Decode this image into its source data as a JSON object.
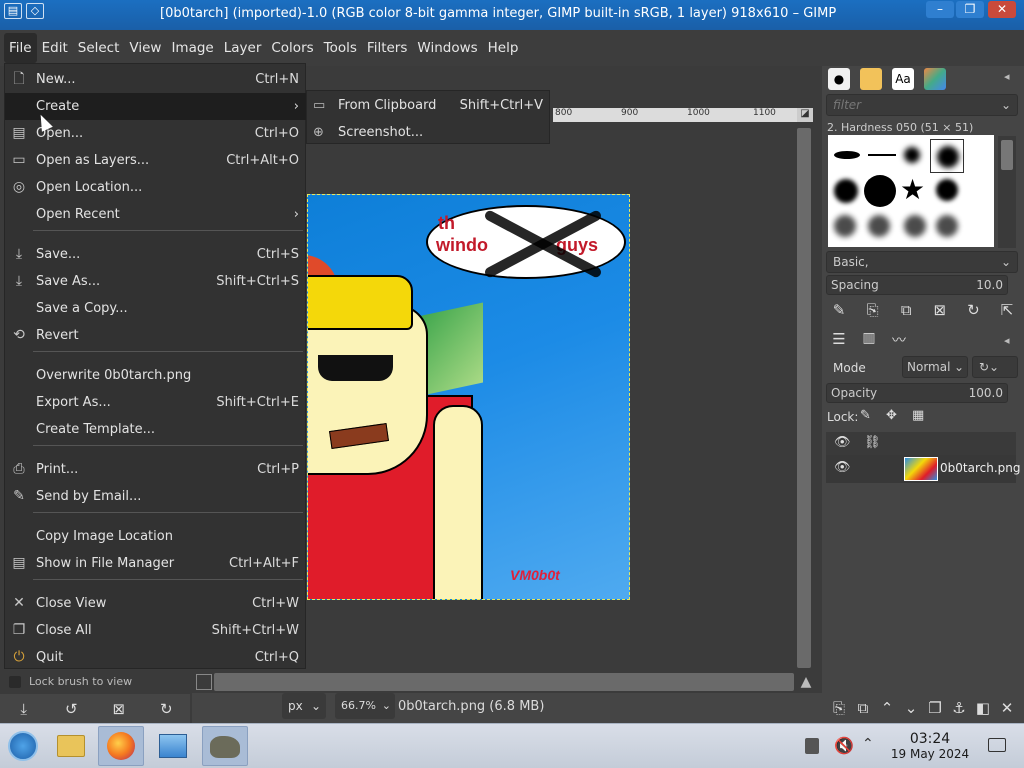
{
  "window": {
    "title": "[0b0tarch] (imported)-1.0 (RGB color 8-bit gamma integer, GIMP built-in sRGB, 1 layer) 918x610 – GIMP",
    "controls": [
      "–",
      "❐",
      "✕"
    ]
  },
  "menubar": [
    "File",
    "Edit",
    "Select",
    "View",
    "Image",
    "Layer",
    "Colors",
    "Tools",
    "Filters",
    "Windows",
    "Help"
  ],
  "file_menu": {
    "items": [
      {
        "label": "New...",
        "shortcut": "Ctrl+N",
        "icon": "new-file-icon"
      },
      {
        "label": "Create",
        "shortcut": "",
        "icon": "",
        "submenu": true,
        "highlight": true
      },
      {
        "label": "Open...",
        "shortcut": "Ctrl+O",
        "icon": "open-icon"
      },
      {
        "label": "Open as Layers...",
        "shortcut": "Ctrl+Alt+O",
        "icon": "open-layers-icon"
      },
      {
        "label": "Open Location...",
        "shortcut": "",
        "icon": "globe-icon"
      },
      {
        "label": "Open Recent",
        "shortcut": "",
        "icon": "",
        "submenu": true
      },
      {
        "label": "Save...",
        "shortcut": "Ctrl+S",
        "icon": "save-icon"
      },
      {
        "label": "Save As...",
        "shortcut": "Shift+Ctrl+S",
        "icon": "save-as-icon"
      },
      {
        "label": "Save a Copy...",
        "shortcut": "",
        "icon": ""
      },
      {
        "label": "Revert",
        "shortcut": "",
        "icon": "revert-icon"
      },
      {
        "label": "Overwrite 0b0tarch.png",
        "shortcut": "",
        "icon": ""
      },
      {
        "label": "Export As...",
        "shortcut": "Shift+Ctrl+E",
        "icon": ""
      },
      {
        "label": "Create Template...",
        "shortcut": "",
        "icon": ""
      },
      {
        "label": "Print...",
        "shortcut": "Ctrl+P",
        "icon": "print-icon"
      },
      {
        "label": "Send by Email...",
        "shortcut": "",
        "icon": "email-icon"
      },
      {
        "label": "Copy Image Location",
        "shortcut": "",
        "icon": ""
      },
      {
        "label": "Show in File Manager",
        "shortcut": "Ctrl+Alt+F",
        "icon": "file-manager-icon"
      },
      {
        "label": "Close View",
        "shortcut": "Ctrl+W",
        "icon": "close-icon"
      },
      {
        "label": "Close All",
        "shortcut": "Shift+Ctrl+W",
        "icon": "close-all-icon"
      },
      {
        "label": "Quit",
        "shortcut": "Ctrl+Q",
        "icon": "quit-icon"
      }
    ]
  },
  "create_submenu": [
    {
      "label": "From Clipboard",
      "shortcut": "Shift+Ctrl+V"
    },
    {
      "label": "Screenshot...",
      "shortcut": ""
    }
  ],
  "ruler_ticks": [
    "800",
    "900",
    "1000",
    "1100"
  ],
  "canvas": {
    "speech_text": "guys",
    "speech_fragment": "windo",
    "speech_top": "th",
    "signature": "VM0b0t"
  },
  "left_dock": {
    "lock_brush_label": "Lock brush to view"
  },
  "statusbar": {
    "unit": "px",
    "zoom": "66.7%",
    "message": "0b0tarch.png (6.8 MB)"
  },
  "brushes": {
    "filter_placeholder": "filter",
    "current_brush": "2. Hardness 050 (51 × 51)",
    "preset": "Basic,",
    "spacing_label": "Spacing",
    "spacing_value": "10.0"
  },
  "layers": {
    "mode_label": "Mode",
    "mode_value": "Normal",
    "opacity_label": "Opacity",
    "opacity_value": "100.0",
    "lock_label": "Lock:",
    "layer_name": "0b0tarch.png"
  },
  "taskbar": {
    "time": "03:24",
    "date": "19 May 2024"
  },
  "colors": {
    "accent": "#1a5fa8",
    "menu_bg": "#323232",
    "highlight": "#1e1e1e"
  }
}
